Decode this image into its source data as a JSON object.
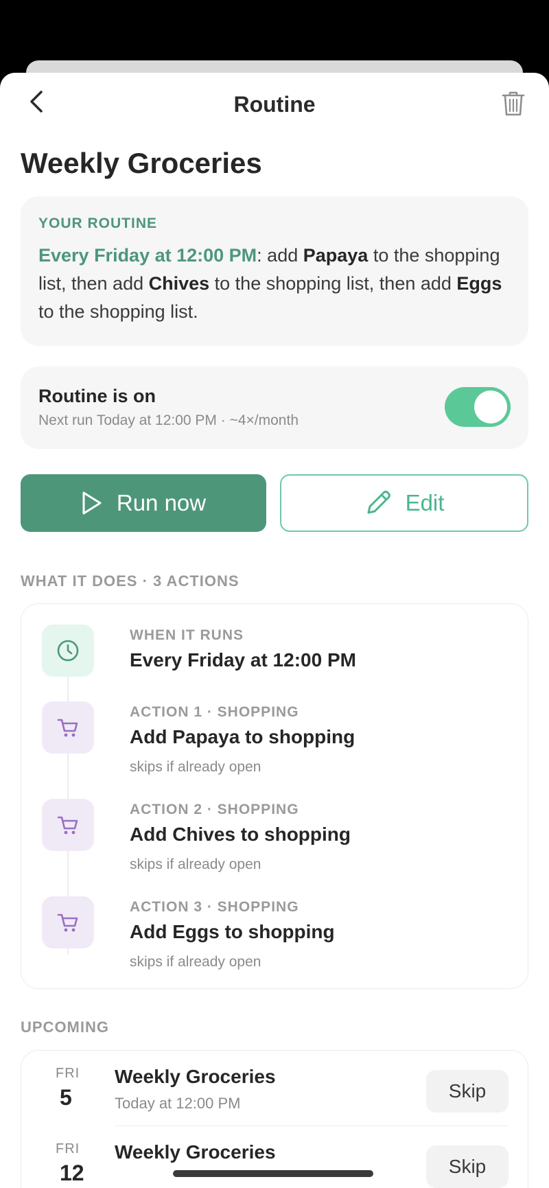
{
  "nav": {
    "title": "Routine"
  },
  "page": {
    "title": "Weekly Groceries"
  },
  "summary": {
    "eyebrow": "YOUR ROUTINE",
    "schedule": "Every Friday at 12:00 PM",
    "t1": ": add ",
    "item1": "Papaya",
    "t2": " to the shopping list, then add ",
    "item2": "Chives",
    "t3": " to the shopping list, then add ",
    "item3": "Eggs",
    "t4": " to the shopping list."
  },
  "status": {
    "title": "Routine is on",
    "next_run": "Next run Today at 12:00 PM · ~4×/month",
    "enabled": true,
    "accent_color": "#5bc997"
  },
  "buttons": {
    "run_now": "Run now",
    "edit": "Edit",
    "primary_color": "#4e967a"
  },
  "what_it_does": {
    "label": "WHAT IT DOES · 3 ACTIONS",
    "trigger": {
      "label": "WHEN IT RUNS",
      "title": "Every Friday at 12:00 PM",
      "icon": "clock-icon"
    },
    "actions": [
      {
        "label": "ACTION 1 · SHOPPING",
        "title": "Add Papaya to shopping",
        "note": "skips if already open",
        "icon": "cart-icon"
      },
      {
        "label": "ACTION 2 · SHOPPING",
        "title": "Add Chives to shopping",
        "note": "skips if already open",
        "icon": "cart-icon"
      },
      {
        "label": "ACTION 3 · SHOPPING",
        "title": "Add Eggs to shopping",
        "note": "skips if already open",
        "icon": "cart-icon"
      }
    ]
  },
  "upcoming": {
    "label": "UPCOMING",
    "items": [
      {
        "dow": "FRI",
        "day": "5",
        "title": "Weekly Groceries",
        "when": "Today at 12:00 PM",
        "action": "Skip"
      },
      {
        "dow": "FRI",
        "day": "12",
        "title": "Weekly Groceries",
        "when": "",
        "action": "Skip"
      }
    ]
  }
}
